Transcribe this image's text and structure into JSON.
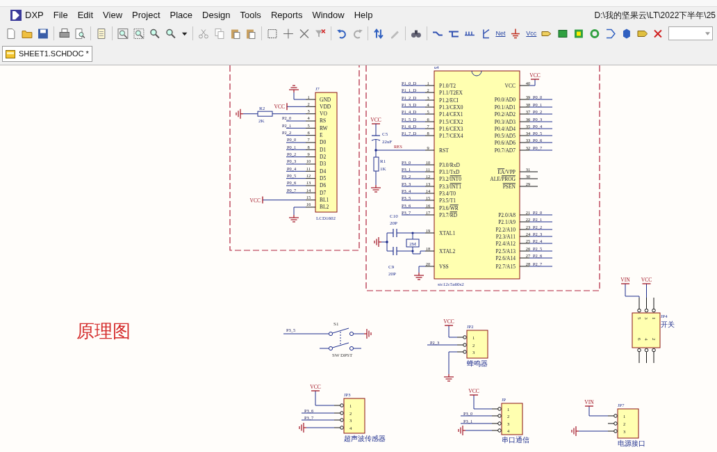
{
  "menu": [
    "DXP",
    "File",
    "Edit",
    "View",
    "Project",
    "Place",
    "Design",
    "Tools",
    "Reports",
    "Window",
    "Help"
  ],
  "path": "D:\\我的坚果云\\LT\\2022下半年\\25",
  "toolbar_texts": [
    "Net",
    "Vcc"
  ],
  "tabs": [
    {
      "label": "SHEET1.SCHDOC *",
      "selected": true
    }
  ],
  "sheet": {
    "title": "原理图",
    "lcd": {
      "ref": "J7",
      "part": "LCD1602",
      "pins": [
        {
          "number": "1",
          "name": "GND"
        },
        {
          "number": "2",
          "name": "VDD",
          "power": "VCC"
        },
        {
          "number": "3",
          "name": "VO"
        },
        {
          "number": "4",
          "name": "RS",
          "net": "P2_0"
        },
        {
          "number": "5",
          "name": "RW",
          "net": "P2_1"
        },
        {
          "number": "6",
          "name": "E",
          "net": "P2_2"
        },
        {
          "number": "7",
          "name": "D0",
          "net": "P0_0"
        },
        {
          "number": "8",
          "name": "D1",
          "net": "P0_1"
        },
        {
          "number": "9",
          "name": "D2",
          "net": "P0_2"
        },
        {
          "number": "10",
          "name": "D3",
          "net": "P0_3"
        },
        {
          "number": "11",
          "name": "D4",
          "net": "P0_4"
        },
        {
          "number": "12",
          "name": "D5",
          "net": "P0_5"
        },
        {
          "number": "13",
          "name": "D6",
          "net": "P0_6"
        },
        {
          "number": "14",
          "name": "D7",
          "net": "P0_7"
        },
        {
          "number": "15",
          "name": "BL1",
          "power": "VCC"
        },
        {
          "number": "16",
          "name": "BL2"
        }
      ]
    },
    "r2": {
      "ref": "R2",
      "value": "2K"
    },
    "mcu": {
      "ref": "u4",
      "part": "stc12c5a60s2",
      "left_pins": [
        {
          "number": "1",
          "name": "P1.0/T2",
          "net": "P1_0_D"
        },
        {
          "number": "2",
          "name": "P1.1/T2EX",
          "net": "P1_1_D"
        },
        {
          "number": "3",
          "name": "P1.2/ECI",
          "net": "P1_2_D"
        },
        {
          "number": "4",
          "name": "P1.3/CEX0",
          "net": "P1_3_D"
        },
        {
          "number": "5",
          "name": "P1.4/CEX1",
          "net": "P1_4_D"
        },
        {
          "number": "6",
          "name": "P1.5/CEX2",
          "net": "P1_5_D"
        },
        {
          "number": "7",
          "name": "P1.6/CEX3",
          "net": "P1_6_D"
        },
        {
          "number": "8",
          "name": "P1.7/CEX4",
          "net": "P1_7_D"
        },
        {
          "number": "9",
          "name": "RST"
        },
        {
          "number": "10",
          "name": "P3.0/RxD",
          "net": "P3_0"
        },
        {
          "number": "11",
          "name": "P3.1/TxD",
          "net": "P3_1"
        },
        {
          "number": "12",
          "name_parts": [
            {
              "text": "P3.2/",
              "overline": false
            },
            {
              "text": "INT0",
              "overline": true
            }
          ],
          "net": "P3_2"
        },
        {
          "number": "13",
          "name_parts": [
            {
              "text": "P3.3/",
              "overline": false
            },
            {
              "text": "INT1",
              "overline": true
            }
          ],
          "net": "P3_3"
        },
        {
          "number": "14",
          "name": "P3.4/T0",
          "net": "P3_4"
        },
        {
          "number": "15",
          "name": "P3.5/T1",
          "net": "P3_5"
        },
        {
          "number": "16",
          "name_parts": [
            {
              "text": "P3.6/",
              "overline": false
            },
            {
              "text": "WR",
              "overline": true
            }
          ],
          "net": "P3_6"
        },
        {
          "number": "17",
          "name_parts": [
            {
              "text": "P3.7/",
              "overline": false
            },
            {
              "text": "RD",
              "overline": true
            }
          ],
          "net": "P3_7"
        },
        {
          "number": "19",
          "name": "XTAL1"
        },
        {
          "number": "18",
          "name": "XTAL2"
        },
        {
          "number": "20",
          "name": "VSS"
        }
      ],
      "right_pins": [
        {
          "number": "40",
          "name": "VCC",
          "power": "VCC"
        },
        {
          "number": "39",
          "name": "P0.0/AD0",
          "net": "P0_0"
        },
        {
          "number": "38",
          "name": "P0.1/AD1",
          "net": "P0_1"
        },
        {
          "number": "37",
          "name": "P0.2/AD2",
          "net": "P0_2"
        },
        {
          "number": "36",
          "name": "P0.3/AD3",
          "net": "P0_3"
        },
        {
          "number": "35",
          "name": "P0.4/AD4",
          "net": "P0_4"
        },
        {
          "number": "34",
          "name": "P0.5/AD5",
          "net": "P0_5"
        },
        {
          "number": "33",
          "name": "P0.6/AD6",
          "net": "P0_6"
        },
        {
          "number": "32",
          "name": "P0.7/AD7",
          "net": "P0_7"
        },
        {
          "number": "31",
          "name_parts": [
            {
              "text": "EA",
              "overline": true
            },
            {
              "text": "/VPP",
              "overline": false
            }
          ]
        },
        {
          "number": "30",
          "name_parts": [
            {
              "text": "ALE/",
              "overline": false
            },
            {
              "text": "PROG",
              "overline": true
            }
          ]
        },
        {
          "number": "29",
          "name_parts": [
            {
              "text": "PSEN",
              "overline": true
            }
          ]
        },
        {
          "number": "21",
          "name": "P2.0/A8",
          "net": "P2_0"
        },
        {
          "number": "22",
          "name": "P2.1/A9",
          "net": "P2_1"
        },
        {
          "number": "23",
          "name": "P2.2/A10",
          "net": "P2_2"
        },
        {
          "number": "24",
          "name": "P2.3/A11",
          "net": "P2_3"
        },
        {
          "number": "25",
          "name": "P2.4/A12",
          "net": "P2_4"
        },
        {
          "number": "26",
          "name": "P2.5/A13",
          "net": "P2_5"
        },
        {
          "number": "27",
          "name": "P2.6/A14",
          "net": "P2_6"
        },
        {
          "number": "28",
          "name": "P2.7/A15",
          "net": "P2_7"
        }
      ]
    },
    "reset": {
      "power": "VCC",
      "cap_ref": "C5",
      "cap_value": "22uF",
      "net": "RES",
      "res_ref": "R1",
      "res_value": "1K"
    },
    "crystal": {
      "c10_ref": "C10",
      "c10_value": "20P",
      "xtal": "2M",
      "c9_ref": "C9",
      "c9_value": "20P"
    },
    "switch": {
      "ref": "S1",
      "part": "SW DPST",
      "net": "P3_5"
    },
    "headers": [
      {
        "ref": "JP2",
        "label": "蜂鸣器",
        "pins": [
          {
            "number": "1",
            "power": "VCC"
          },
          {
            "number": "2",
            "net": "P2_3"
          },
          {
            "number": "3"
          }
        ]
      },
      {
        "ref": "JP3",
        "label": "超声波传感器",
        "pins": [
          {
            "number": "1",
            "power": "VCC"
          },
          {
            "number": "2",
            "net": "P3_6"
          },
          {
            "number": "3",
            "net": "P3_7"
          },
          {
            "number": "4"
          }
        ]
      },
      {
        "ref": "JP",
        "label": "串口通信",
        "pins": [
          {
            "number": "1",
            "power": "VCC"
          },
          {
            "number": "2",
            "net": "P3_0"
          },
          {
            "number": "3",
            "net": "P3_1"
          },
          {
            "number": "4"
          }
        ]
      },
      {
        "ref": "JP7",
        "label": "电源接口",
        "pins": [
          {
            "number": "1",
            "power": "VIN"
          },
          {
            "number": "2"
          },
          {
            "number": "3"
          }
        ]
      }
    ],
    "jp4": {
      "ref": "JP4",
      "label": "开关",
      "top_pins": [
        {
          "number": "5",
          "power": "VIN"
        },
        {
          "number": "3",
          "power": "VCC"
        },
        {
          "number": "1"
        }
      ],
      "bottom_pins": [
        {
          "number": "6"
        },
        {
          "number": "4"
        },
        {
          "number": "2"
        }
      ]
    }
  }
}
